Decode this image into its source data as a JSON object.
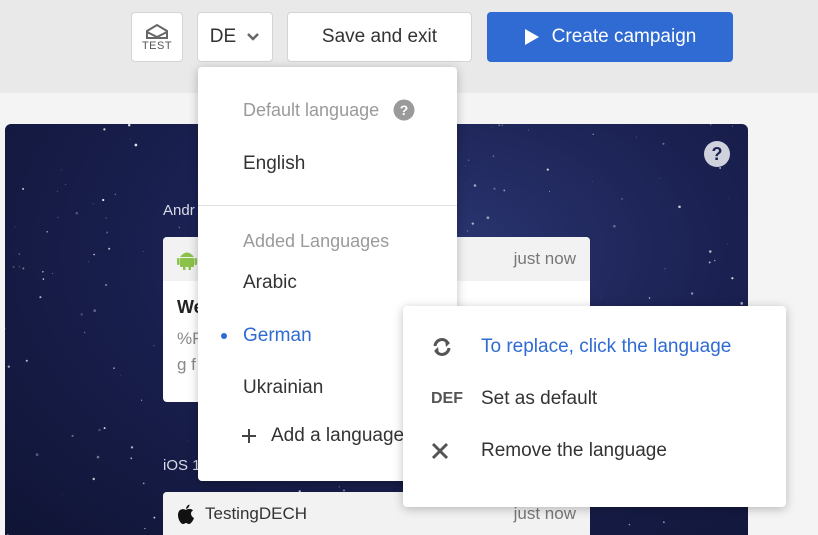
{
  "toolbar": {
    "test_label": "TEST",
    "language_code": "DE",
    "save_label": "Save and exit",
    "create_label": "Create campaign"
  },
  "preview": {
    "android_label": "Andr",
    "android_notif": {
      "time": "just now",
      "title": "We",
      "body_line1": "%F",
      "body_line2": "g f"
    },
    "ios_label": "iOS 1",
    "ios_notif": {
      "app_name": "TestingDECH",
      "time": "just now"
    }
  },
  "language_menu": {
    "default_header": "Default language",
    "default_language": "English",
    "added_header": "Added Languages",
    "languages": [
      "Arabic",
      "German",
      "Ukrainian"
    ],
    "selected": "German",
    "add_label": "Add a language"
  },
  "context_menu": {
    "items": [
      {
        "icon": "refresh-icon",
        "label": "To replace, click the language"
      },
      {
        "icon": "def-icon",
        "icon_text": "DEF",
        "label": "Set as default"
      },
      {
        "icon": "close-icon",
        "label": "Remove the language"
      }
    ]
  },
  "colors": {
    "accent": "#2f6bd3",
    "toolbar_bg": "#e9e9e9",
    "preview_bg": "#1a2050"
  }
}
